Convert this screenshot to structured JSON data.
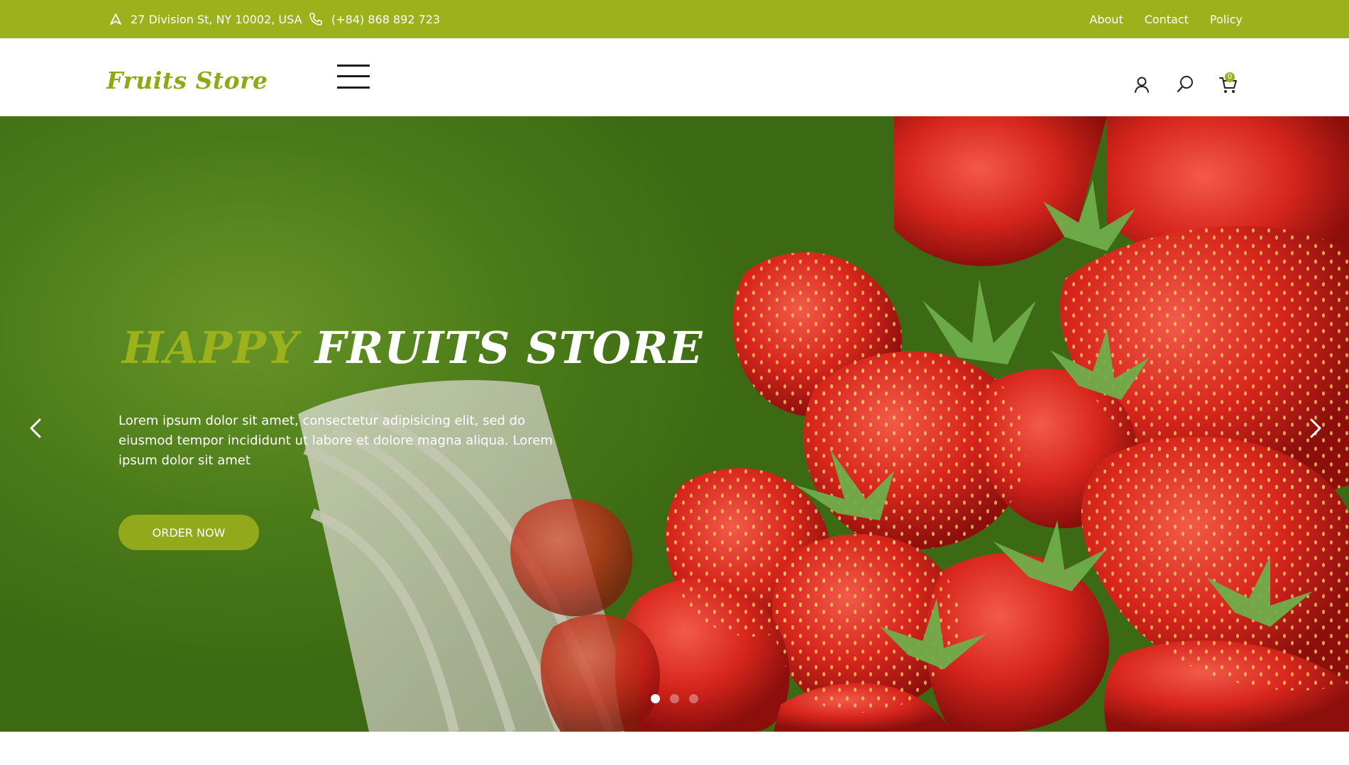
{
  "topbar": {
    "address": "27 Division St, NY 10002, USA",
    "phone": "(+84) 868 892 723",
    "links": [
      "About",
      "Contact",
      "Policy"
    ]
  },
  "header": {
    "logo": "Fruits Store",
    "cart_count": "0",
    "icons": [
      "menu-icon",
      "user-icon",
      "search-icon",
      "cart-icon"
    ]
  },
  "hero": {
    "title_highlight": "HAPPY",
    "title_rest": "FRUITS STORE",
    "text": "Lorem ipsum dolor sit amet, consectetur adipisicing elit, sed do eiusmod tempor incididunt ut labore et dolore magna aliqua. Lorem ipsum dolor sit amet",
    "button_label": "ORDER NOW",
    "slides_total": 3,
    "active_slide": 1
  },
  "colors": {
    "brand": "#9bb21d",
    "text_light": "#ffffff",
    "dark": "#1c1c1c"
  }
}
